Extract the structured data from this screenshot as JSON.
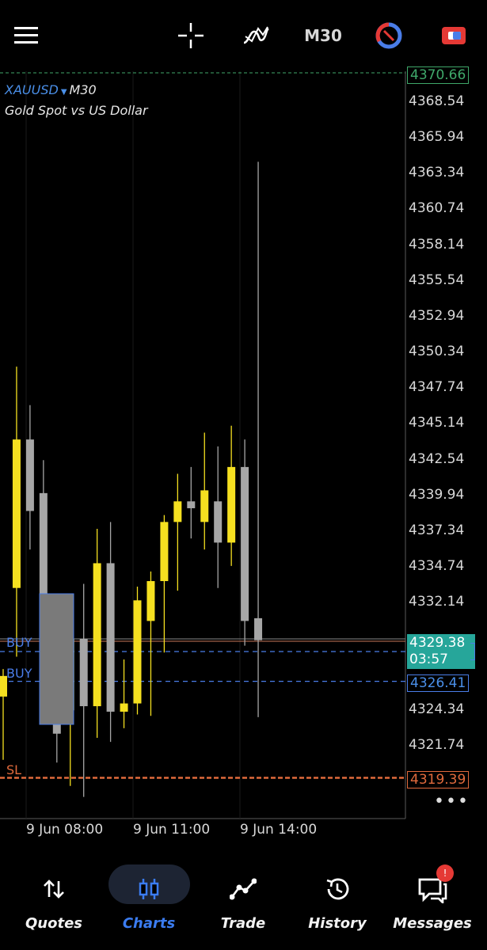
{
  "toolbar": {
    "timeframe": "M30",
    "icons": [
      "menu-icon",
      "crosshair-icon",
      "indicators-icon",
      "one-click-trading-icon",
      "trade-icon"
    ]
  },
  "chart_header": {
    "symbol": "XAUUSD",
    "timeframe": "M30",
    "description": "Gold Spot vs US Dollar"
  },
  "price_scale": {
    "labels": [
      "4368.54",
      "4365.94",
      "4363.34",
      "4360.74",
      "4358.14",
      "4355.54",
      "4352.94",
      "4350.34",
      "4347.74",
      "4345.14",
      "4342.54",
      "4339.94",
      "4337.34",
      "4334.74",
      "4332.14",
      "4324.34",
      "4321.74"
    ],
    "top_tag": "4370.66",
    "current_price": "4329.38",
    "countdown": "03:57",
    "buy_price": "4326.41",
    "sl_price": "4319.39"
  },
  "time_scale": {
    "labels": [
      "9 Jun 08:00",
      "9 Jun 11:00",
      "9 Jun 14:00"
    ]
  },
  "order_lines": {
    "buy1": "BUY",
    "buy2": "BUY",
    "sl": "SL"
  },
  "colors": {
    "bull": "#f5e020",
    "bear": "#a6a6a6",
    "buy_line": "#4a7de8",
    "sl_line": "#e06a3c",
    "current_tag": "#26a69a",
    "accent": "#3b7cf0"
  },
  "chart_data": {
    "type": "candlestick",
    "symbol": "XAUUSD",
    "timeframe": "M30",
    "ylim": [
      4317.5,
      4371.0
    ],
    "candles": [
      {
        "o": 4325.3,
        "h": 4327.3,
        "l": 4320.7,
        "c": 4326.8
      },
      {
        "o": 4333.2,
        "h": 4349.3,
        "l": 4328.2,
        "c": 4344.0
      },
      {
        "o": 4344.0,
        "h": 4346.5,
        "l": 4336.0,
        "c": 4338.8
      },
      {
        "o": 4340.1,
        "h": 4342.5,
        "l": 4324.3,
        "c": 4331.5
      },
      {
        "o": 4332.5,
        "h": 4332.5,
        "l": 4320.5,
        "c": 4322.6
      },
      {
        "o": 4324.3,
        "h": 4328.0,
        "l": 4318.8,
        "c": 4329.5
      },
      {
        "o": 4329.5,
        "h": 4333.5,
        "l": 4318.0,
        "c": 4324.6
      },
      {
        "o": 4324.6,
        "h": 4337.5,
        "l": 4322.3,
        "c": 4335.0
      },
      {
        "o": 4335.0,
        "h": 4338.0,
        "l": 4322.0,
        "c": 4324.2
      },
      {
        "o": 4324.2,
        "h": 4328.0,
        "l": 4323.0,
        "c": 4324.8
      },
      {
        "o": 4324.8,
        "h": 4333.3,
        "l": 4324.0,
        "c": 4332.3
      },
      {
        "o": 4330.8,
        "h": 4334.4,
        "l": 4323.9,
        "c": 4333.7
      },
      {
        "o": 4333.7,
        "h": 4338.5,
        "l": 4328.5,
        "c": 4338.0
      },
      {
        "o": 4338.0,
        "h": 4341.5,
        "l": 4333.0,
        "c": 4339.5
      },
      {
        "o": 4339.5,
        "h": 4342.0,
        "l": 4336.8,
        "c": 4339.0
      },
      {
        "o": 4338.0,
        "h": 4344.5,
        "l": 4336.0,
        "c": 4340.3
      },
      {
        "o": 4339.5,
        "h": 4343.5,
        "l": 4333.2,
        "c": 4336.5
      },
      {
        "o": 4336.5,
        "h": 4345.0,
        "l": 4334.8,
        "c": 4342.0
      },
      {
        "o": 4342.0,
        "h": 4344.0,
        "l": 4329.0,
        "c": 4330.8
      },
      {
        "o": 4331.0,
        "h": 4364.2,
        "l": 4323.8,
        "c": 4329.4
      }
    ],
    "levels": {
      "buy1": 4328.3,
      "buy2": 4326.41,
      "sl": 4319.39,
      "current": 4329.38
    }
  },
  "bottom_nav": {
    "items": [
      {
        "label": "Quotes",
        "icon": "quotes-icon"
      },
      {
        "label": "Charts",
        "icon": "charts-icon"
      },
      {
        "label": "Trade",
        "icon": "trade-line-icon"
      },
      {
        "label": "History",
        "icon": "history-icon"
      },
      {
        "label": "Messages",
        "icon": "messages-icon"
      }
    ],
    "messages_badge": "!"
  }
}
